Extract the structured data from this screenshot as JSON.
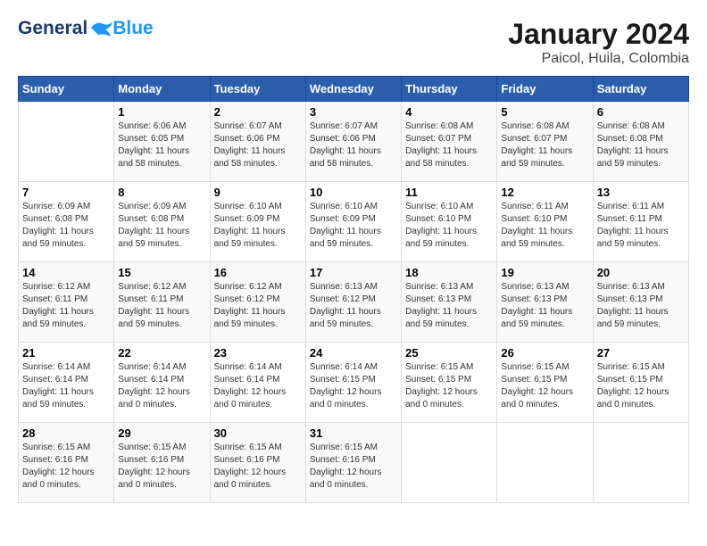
{
  "logo": {
    "line1": "General",
    "line2": "Blue"
  },
  "title": "January 2024",
  "subtitle": "Paicol, Huila, Colombia",
  "days_of_week": [
    "Sunday",
    "Monday",
    "Tuesday",
    "Wednesday",
    "Thursday",
    "Friday",
    "Saturday"
  ],
  "weeks": [
    [
      {
        "day": "",
        "sunrise": "",
        "sunset": "",
        "daylight": ""
      },
      {
        "day": "1",
        "sunrise": "Sunrise: 6:06 AM",
        "sunset": "Sunset: 6:05 PM",
        "daylight": "Daylight: 11 hours and 58 minutes."
      },
      {
        "day": "2",
        "sunrise": "Sunrise: 6:07 AM",
        "sunset": "Sunset: 6:06 PM",
        "daylight": "Daylight: 11 hours and 58 minutes."
      },
      {
        "day": "3",
        "sunrise": "Sunrise: 6:07 AM",
        "sunset": "Sunset: 6:06 PM",
        "daylight": "Daylight: 11 hours and 58 minutes."
      },
      {
        "day": "4",
        "sunrise": "Sunrise: 6:08 AM",
        "sunset": "Sunset: 6:07 PM",
        "daylight": "Daylight: 11 hours and 58 minutes."
      },
      {
        "day": "5",
        "sunrise": "Sunrise: 6:08 AM",
        "sunset": "Sunset: 6:07 PM",
        "daylight": "Daylight: 11 hours and 59 minutes."
      },
      {
        "day": "6",
        "sunrise": "Sunrise: 6:08 AM",
        "sunset": "Sunset: 6:08 PM",
        "daylight": "Daylight: 11 hours and 59 minutes."
      }
    ],
    [
      {
        "day": "7",
        "sunrise": "Sunrise: 6:09 AM",
        "sunset": "Sunset: 6:08 PM",
        "daylight": "Daylight: 11 hours and 59 minutes."
      },
      {
        "day": "8",
        "sunrise": "Sunrise: 6:09 AM",
        "sunset": "Sunset: 6:08 PM",
        "daylight": "Daylight: 11 hours and 59 minutes."
      },
      {
        "day": "9",
        "sunrise": "Sunrise: 6:10 AM",
        "sunset": "Sunset: 6:09 PM",
        "daylight": "Daylight: 11 hours and 59 minutes."
      },
      {
        "day": "10",
        "sunrise": "Sunrise: 6:10 AM",
        "sunset": "Sunset: 6:09 PM",
        "daylight": "Daylight: 11 hours and 59 minutes."
      },
      {
        "day": "11",
        "sunrise": "Sunrise: 6:10 AM",
        "sunset": "Sunset: 6:10 PM",
        "daylight": "Daylight: 11 hours and 59 minutes."
      },
      {
        "day": "12",
        "sunrise": "Sunrise: 6:11 AM",
        "sunset": "Sunset: 6:10 PM",
        "daylight": "Daylight: 11 hours and 59 minutes."
      },
      {
        "day": "13",
        "sunrise": "Sunrise: 6:11 AM",
        "sunset": "Sunset: 6:11 PM",
        "daylight": "Daylight: 11 hours and 59 minutes."
      }
    ],
    [
      {
        "day": "14",
        "sunrise": "Sunrise: 6:12 AM",
        "sunset": "Sunset: 6:11 PM",
        "daylight": "Daylight: 11 hours and 59 minutes."
      },
      {
        "day": "15",
        "sunrise": "Sunrise: 6:12 AM",
        "sunset": "Sunset: 6:11 PM",
        "daylight": "Daylight: 11 hours and 59 minutes."
      },
      {
        "day": "16",
        "sunrise": "Sunrise: 6:12 AM",
        "sunset": "Sunset: 6:12 PM",
        "daylight": "Daylight: 11 hours and 59 minutes."
      },
      {
        "day": "17",
        "sunrise": "Sunrise: 6:13 AM",
        "sunset": "Sunset: 6:12 PM",
        "daylight": "Daylight: 11 hours and 59 minutes."
      },
      {
        "day": "18",
        "sunrise": "Sunrise: 6:13 AM",
        "sunset": "Sunset: 6:13 PM",
        "daylight": "Daylight: 11 hours and 59 minutes."
      },
      {
        "day": "19",
        "sunrise": "Sunrise: 6:13 AM",
        "sunset": "Sunset: 6:13 PM",
        "daylight": "Daylight: 11 hours and 59 minutes."
      },
      {
        "day": "20",
        "sunrise": "Sunrise: 6:13 AM",
        "sunset": "Sunset: 6:13 PM",
        "daylight": "Daylight: 11 hours and 59 minutes."
      }
    ],
    [
      {
        "day": "21",
        "sunrise": "Sunrise: 6:14 AM",
        "sunset": "Sunset: 6:14 PM",
        "daylight": "Daylight: 11 hours and 59 minutes."
      },
      {
        "day": "22",
        "sunrise": "Sunrise: 6:14 AM",
        "sunset": "Sunset: 6:14 PM",
        "daylight": "Daylight: 12 hours and 0 minutes."
      },
      {
        "day": "23",
        "sunrise": "Sunrise: 6:14 AM",
        "sunset": "Sunset: 6:14 PM",
        "daylight": "Daylight: 12 hours and 0 minutes."
      },
      {
        "day": "24",
        "sunrise": "Sunrise: 6:14 AM",
        "sunset": "Sunset: 6:15 PM",
        "daylight": "Daylight: 12 hours and 0 minutes."
      },
      {
        "day": "25",
        "sunrise": "Sunrise: 6:15 AM",
        "sunset": "Sunset: 6:15 PM",
        "daylight": "Daylight: 12 hours and 0 minutes."
      },
      {
        "day": "26",
        "sunrise": "Sunrise: 6:15 AM",
        "sunset": "Sunset: 6:15 PM",
        "daylight": "Daylight: 12 hours and 0 minutes."
      },
      {
        "day": "27",
        "sunrise": "Sunrise: 6:15 AM",
        "sunset": "Sunset: 6:15 PM",
        "daylight": "Daylight: 12 hours and 0 minutes."
      }
    ],
    [
      {
        "day": "28",
        "sunrise": "Sunrise: 6:15 AM",
        "sunset": "Sunset: 6:16 PM",
        "daylight": "Daylight: 12 hours and 0 minutes."
      },
      {
        "day": "29",
        "sunrise": "Sunrise: 6:15 AM",
        "sunset": "Sunset: 6:16 PM",
        "daylight": "Daylight: 12 hours and 0 minutes."
      },
      {
        "day": "30",
        "sunrise": "Sunrise: 6:15 AM",
        "sunset": "Sunset: 6:16 PM",
        "daylight": "Daylight: 12 hours and 0 minutes."
      },
      {
        "day": "31",
        "sunrise": "Sunrise: 6:15 AM",
        "sunset": "Sunset: 6:16 PM",
        "daylight": "Daylight: 12 hours and 0 minutes."
      },
      {
        "day": "",
        "sunrise": "",
        "sunset": "",
        "daylight": ""
      },
      {
        "day": "",
        "sunrise": "",
        "sunset": "",
        "daylight": ""
      },
      {
        "day": "",
        "sunrise": "",
        "sunset": "",
        "daylight": ""
      }
    ]
  ]
}
